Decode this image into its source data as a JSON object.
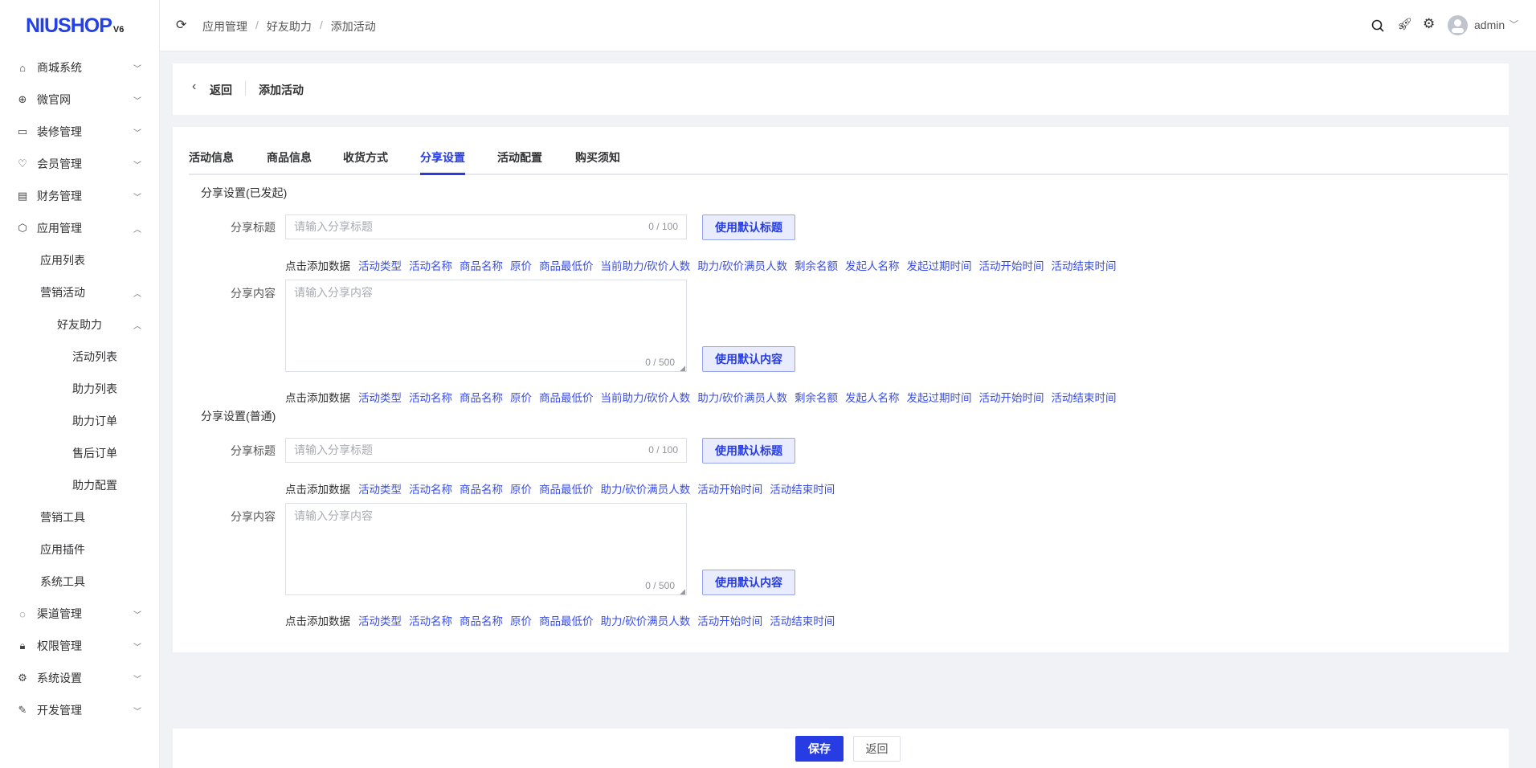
{
  "logo": {
    "text": "NIUSHOP",
    "version": "V6"
  },
  "sidebar": {
    "items": [
      {
        "label": "商城系统",
        "icon": "bag-icon",
        "level": 1,
        "chev": "down"
      },
      {
        "label": "微官网",
        "icon": "globe-icon",
        "level": 1,
        "chev": "down"
      },
      {
        "label": "装修管理",
        "icon": "decor-icon",
        "level": 1,
        "chev": "down"
      },
      {
        "label": "会员管理",
        "icon": "diamond-icon",
        "level": 1,
        "chev": "down"
      },
      {
        "label": "财务管理",
        "icon": "finance-icon",
        "level": 1,
        "chev": "down"
      },
      {
        "label": "应用管理",
        "icon": "cube-icon",
        "level": 1,
        "chev": "up"
      },
      {
        "label": "应用列表",
        "level": 2
      },
      {
        "label": "营销活动",
        "level": 2,
        "chev": "up"
      },
      {
        "label": "好友助力",
        "level": 3,
        "chev": "up"
      },
      {
        "label": "活动列表",
        "level": 4
      },
      {
        "label": "助力列表",
        "level": 4
      },
      {
        "label": "助力订单",
        "level": 4
      },
      {
        "label": "售后订单",
        "level": 4
      },
      {
        "label": "助力配置",
        "level": 4
      },
      {
        "label": "营销工具",
        "level": 2
      },
      {
        "label": "应用插件",
        "level": 2
      },
      {
        "label": "系统工具",
        "level": 2
      },
      {
        "label": "渠道管理",
        "icon": "channel-icon",
        "level": 1,
        "chev": "down"
      },
      {
        "label": "权限管理",
        "icon": "lock-icon",
        "level": 1,
        "chev": "down"
      },
      {
        "label": "系统设置",
        "icon": "gear-icon",
        "level": 1,
        "chev": "down"
      },
      {
        "label": "开发管理",
        "icon": "edit-icon",
        "level": 1,
        "chev": "down"
      }
    ]
  },
  "header": {
    "breadcrumb": [
      "应用管理",
      "好友助力",
      "添加活动"
    ],
    "sep": "/",
    "user": "admin"
  },
  "page_header": {
    "back": "返回",
    "title": "添加活动"
  },
  "tabs": [
    "活动信息",
    "商品信息",
    "收货方式",
    "分享设置",
    "活动配置",
    "购买须知"
  ],
  "active_tab": 3,
  "sections": [
    {
      "title": "分享设置(已发起)",
      "title_label": "分享标题",
      "title_placeholder": "请输入分享标题",
      "title_count": "0 / 100",
      "title_btn": "使用默认标题",
      "content_label": "分享内容",
      "content_placeholder": "请输入分享内容",
      "content_count": "0 / 500",
      "content_btn": "使用默认内容",
      "hint_label": "点击添加数据",
      "vars": [
        "活动类型",
        "活动名称",
        "商品名称",
        "原价",
        "商品最低价",
        "当前助力/砍价人数",
        "助力/砍价满员人数",
        "剩余名额",
        "发起人名称",
        "发起过期时间",
        "活动开始时间",
        "活动结束时间"
      ]
    },
    {
      "title": "分享设置(普通)",
      "title_label": "分享标题",
      "title_placeholder": "请输入分享标题",
      "title_count": "0 / 100",
      "title_btn": "使用默认标题",
      "content_label": "分享内容",
      "content_placeholder": "请输入分享内容",
      "content_count": "0 / 500",
      "content_btn": "使用默认内容",
      "hint_label": "点击添加数据",
      "vars": [
        "活动类型",
        "活动名称",
        "商品名称",
        "原价",
        "商品最低价",
        "助力/砍价满员人数",
        "活动开始时间",
        "活动结束时间"
      ]
    }
  ],
  "footer": {
    "save": "保存",
    "back": "返回"
  },
  "colors": {
    "primary": "#273de3"
  }
}
